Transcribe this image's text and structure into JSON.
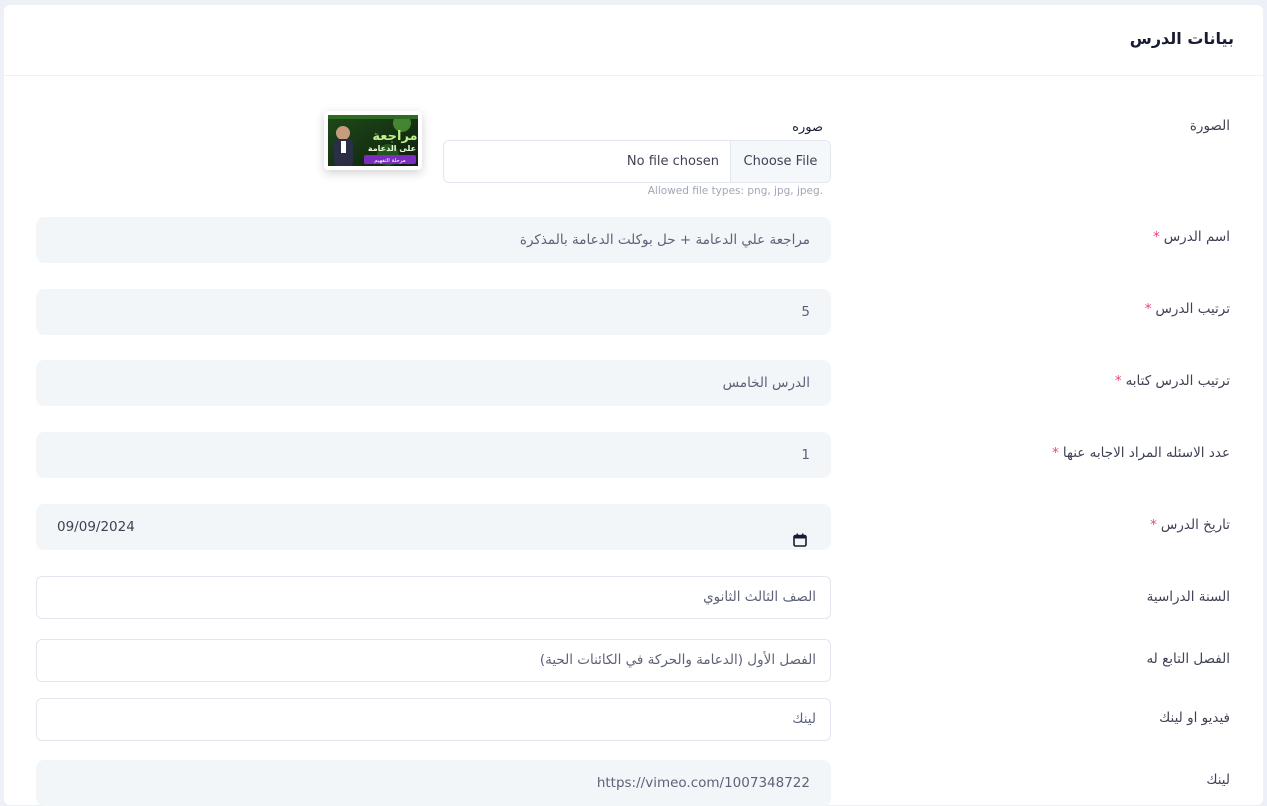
{
  "card": {
    "title": "بيانات الدرس"
  },
  "image_field": {
    "label": "الصورة",
    "caption": "صوره",
    "button_label": "Choose File",
    "file_status": "No file chosen",
    "hint": "Allowed file types: png, jpg, jpeg.",
    "thumbnail_text": {
      "headline_1": "مراجعة",
      "headline_2": "على الدعامة",
      "banner": "مرحلة التفهيم"
    }
  },
  "fields": {
    "lesson_name": {
      "label": "اسم الدرس",
      "required": "*",
      "value": "مراجعة علي الدعامة + حل بوكلت الدعامة بالمذكرة"
    },
    "lesson_order": {
      "label": "ترتيب الدرس",
      "required": "*",
      "value": "5"
    },
    "lesson_order_text": {
      "label": "ترتيب الدرس كتابه",
      "required": "*",
      "value": "الدرس الخامس"
    },
    "questions_count": {
      "label": "عدد الاسئله المراد الاجابه عنها",
      "required": "*",
      "value": "1"
    },
    "lesson_date": {
      "label": "تاريخ الدرس",
      "required": "*",
      "value": "09/09/2024"
    },
    "school_year": {
      "label": "السنة الدراسية",
      "value": "الصف الثالث الثانوي"
    },
    "chapter": {
      "label": "الفصل التابع له",
      "value": "الفصل الأول (الدعامة والحركة في الكائنات الحية)"
    },
    "video_or_link": {
      "label": "فيديو او لينك",
      "value": "لينك"
    },
    "link": {
      "label": "لينك",
      "value": "https://vimeo.com/1007348722"
    }
  },
  "icons": {
    "calendar": "calendar-icon"
  },
  "colors": {
    "required": "#f1416c",
    "solid_input_bg": "#f3f6f9",
    "page_bg": "#eef0f8"
  }
}
